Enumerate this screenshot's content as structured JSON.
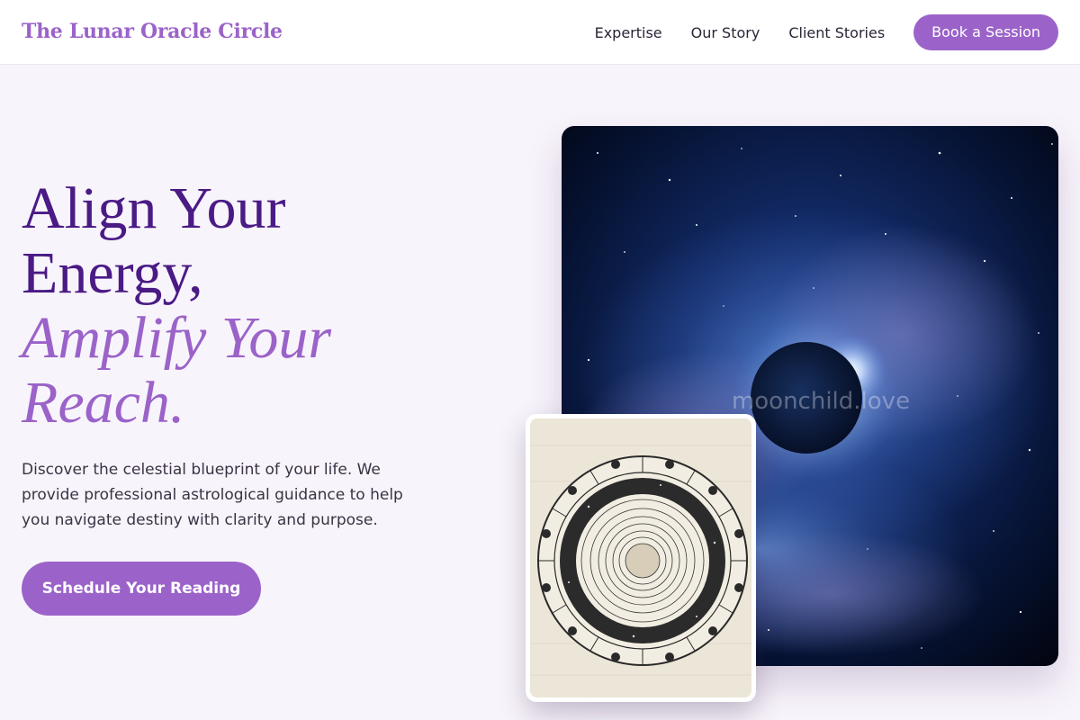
{
  "header": {
    "brand": "The Lunar Oracle Circle",
    "nav": [
      "Expertise",
      "Our Story",
      "Client Stories"
    ],
    "cta_label": "Book a Session"
  },
  "hero": {
    "title_line1": "Align Your",
    "title_line2": "Energy,",
    "title_accent1": "Amplify Your",
    "title_accent2": "Reach.",
    "description": "Discover the celestial blueprint of your life. We provide professional astrological guidance to help you navigate destiny with clarity and purpose.",
    "button_label": "Schedule Your Reading"
  },
  "images": {
    "space_watermark": "moonchild.love"
  },
  "colors": {
    "brand": "#9b63c9",
    "heading": "#4a1a85",
    "background": "#f8f4fb"
  }
}
